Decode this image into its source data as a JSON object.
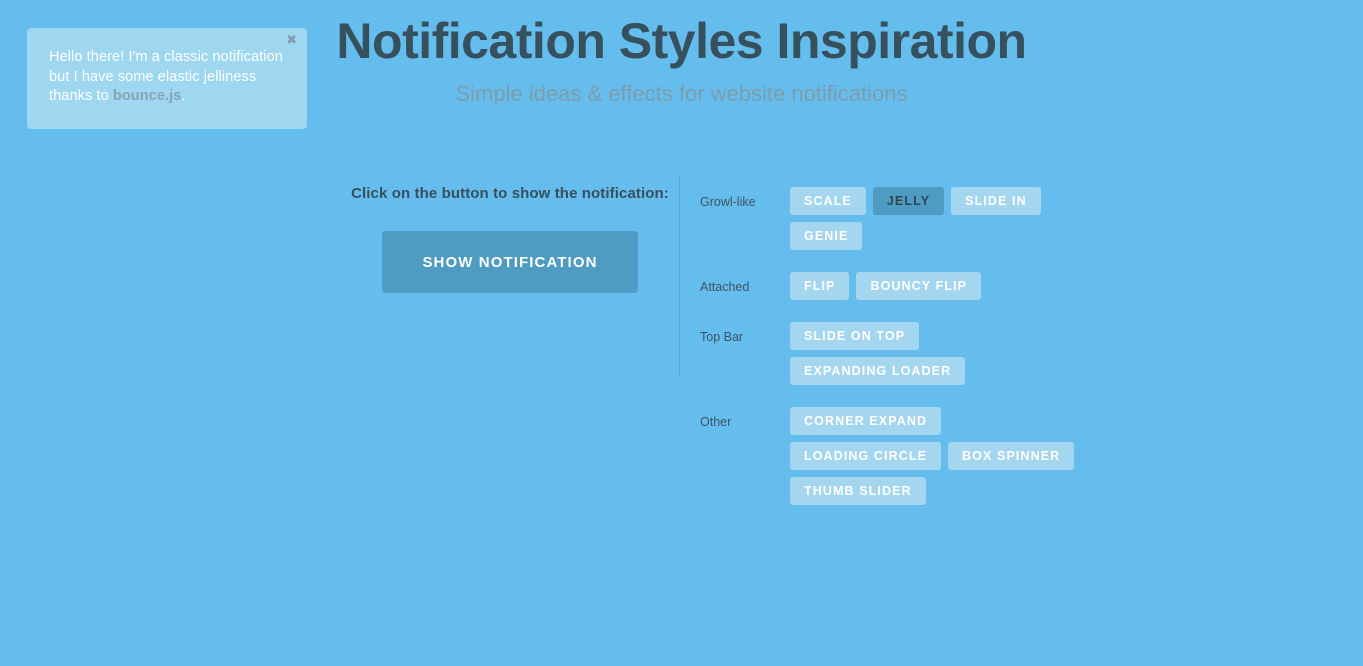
{
  "header": {
    "title": "Notification Styles Inspiration",
    "subtitle": "Simple ideas & effects for website notifications"
  },
  "notification": {
    "message_part1": "Hello there! I'm a classic notification but I have some elastic jelliness thanks to ",
    "link_text": "bounce.js",
    "message_part2": ".",
    "close_icon": "close-icon",
    "close_glyph": "✖",
    "background_color": "#9fd6f0",
    "text_color": "#ffffff",
    "link_color": "#84a6b5"
  },
  "trigger": {
    "label": "Click on the button to show the notification:",
    "button_label": "SHOW NOTIFICATION",
    "button_color": "#4e9cc2"
  },
  "options": {
    "groups": [
      {
        "label": "Growl-like",
        "buttons": [
          {
            "label": "SCALE",
            "selected": false
          },
          {
            "label": "JELLY",
            "selected": true
          },
          {
            "label": "SLIDE IN",
            "selected": false
          },
          {
            "label": "GENIE",
            "selected": false
          }
        ]
      },
      {
        "label": "Attached",
        "buttons": [
          {
            "label": "FLIP",
            "selected": false
          },
          {
            "label": "BOUNCY FLIP",
            "selected": false
          }
        ]
      },
      {
        "label": "Top Bar",
        "buttons": [
          {
            "label": "SLIDE ON TOP",
            "selected": false
          },
          {
            "label": "EXPANDING LOADER",
            "selected": false
          }
        ]
      },
      {
        "label": "Other",
        "buttons": [
          {
            "label": "CORNER EXPAND",
            "selected": false
          },
          {
            "label": "LOADING CIRCLE",
            "selected": false
          },
          {
            "label": "BOX SPINNER",
            "selected": false
          },
          {
            "label": "THUMB SLIDER",
            "selected": false
          }
        ]
      }
    ],
    "unselected_color": "#a4d6f0",
    "selected_color": "#4e9cc2"
  },
  "page": {
    "background_color": "#65bdee",
    "title_color": "#36505e",
    "subtitle_color": "#7e9dac",
    "divider_color": "#58a8d6"
  }
}
